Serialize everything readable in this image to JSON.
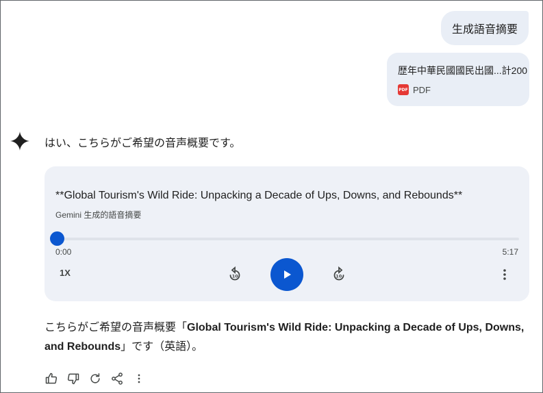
{
  "user_message": {
    "text": "生成語音摘要"
  },
  "attachment": {
    "file_name": "歴年中華民國國民出國...計200",
    "file_type": "PDF",
    "file_icon": "pdf-icon"
  },
  "response": {
    "intro": "はい、こちらがご希望の音声概要です。",
    "body_prefix": "こちらがご希望の音声概要「",
    "body_title": "Global Tourism's Wild Ride: Unpacking a Decade of Ups, Downs, and Rebounds",
    "body_suffix": "」です（英語）。"
  },
  "audio": {
    "title": "**Global Tourism's Wild Ride: Unpacking a Decade of Ups, Downs, and Rebounds**",
    "subtitle": "Gemini 生成的語音摘要",
    "current_time": "0:00",
    "total_time": "5:17",
    "progress": 0,
    "speed_label": "1X",
    "accent_color": "#0b57d0"
  },
  "icons": {
    "spark": "gemini-spark-icon",
    "rewind": "replay-10-icon",
    "play": "play-icon",
    "forward": "forward-10-icon",
    "more": "more-vert-icon",
    "thumbs_up": "thumb-up-icon",
    "thumbs_down": "thumb-down-icon",
    "regenerate": "refresh-icon",
    "share": "share-icon"
  }
}
